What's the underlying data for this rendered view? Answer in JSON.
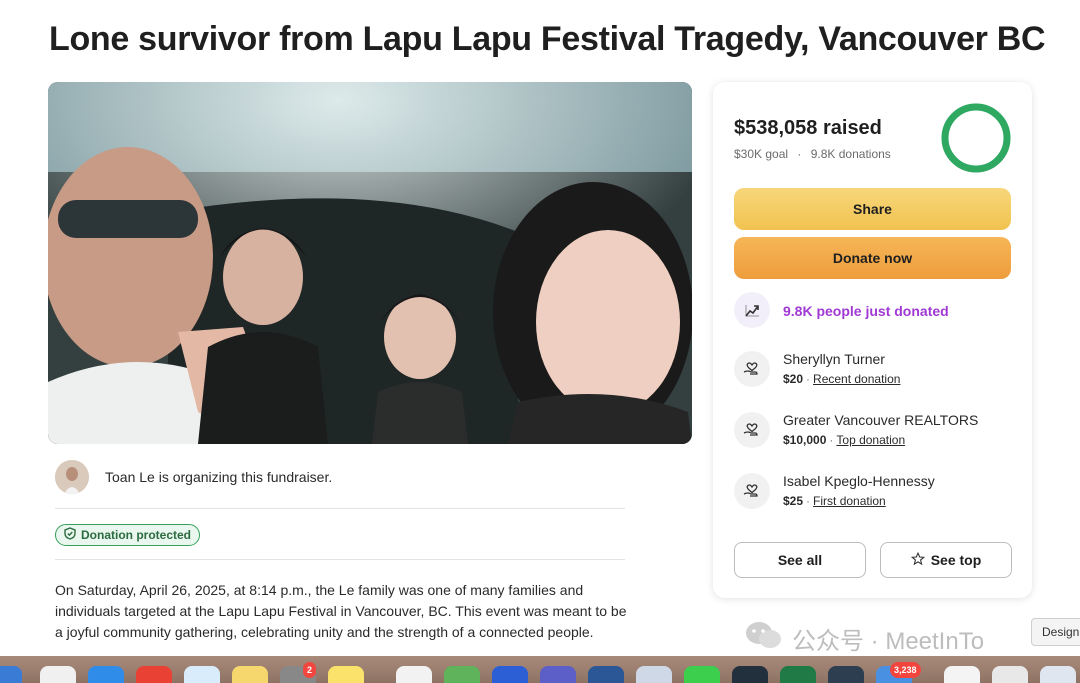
{
  "page": {
    "title": "Lone survivor from Lapu Lapu Festival Tragedy, Vancouver BC"
  },
  "organizer": {
    "text": "Toan Le is organizing this fundraiser."
  },
  "protection": {
    "label": "Donation protected"
  },
  "story": {
    "text": "On Saturday, April 26, 2025, at 8:14 p.m., the Le family was one of many families and individuals targeted at the Lapu Lapu Festival in Vancouver, BC. This event was meant to be a joyful community gathering, celebrating unity and the strength of a connected people."
  },
  "summary": {
    "raised": "$538,058 raised",
    "goal": "$30K goal",
    "dot": "·",
    "donations": "9.8K donations",
    "progress_fraction": 1.0
  },
  "actions": {
    "share_label": "Share",
    "donate_label": "Donate now",
    "see_all_label": "See all",
    "see_top_label": "See top"
  },
  "activity": {
    "just_donated": "9.8K people just donated"
  },
  "donors": [
    {
      "name": "Sheryllyn Turner",
      "amount": "$20",
      "sep": "·",
      "kind": "Recent donation"
    },
    {
      "name": "Greater Vancouver REALTORS",
      "amount": "$10,000",
      "sep": "·",
      "kind": "Top donation"
    },
    {
      "name": "Isabel Kpeglo-Hennessy",
      "amount": "$25",
      "sep": "·",
      "kind": "First donation"
    }
  ],
  "watermark": {
    "text": "公众号 · MeetInTo"
  },
  "tooltip": {
    "text": "Design"
  },
  "dock": {
    "badge_1": "2",
    "badge_2": "3,238"
  },
  "colors": {
    "accent_purple": "#a039d4",
    "share_yellow": "#f1c24f",
    "donate_orange": "#ee9d3c",
    "progress_green": "#2fa862",
    "protected_green": "#35a05a"
  },
  "icons": {
    "trend": "trend-up-icon",
    "donor": "heart-hand-icon",
    "shield": "shield-check-icon",
    "star": "star-icon",
    "wechat": "wechat-icon"
  }
}
